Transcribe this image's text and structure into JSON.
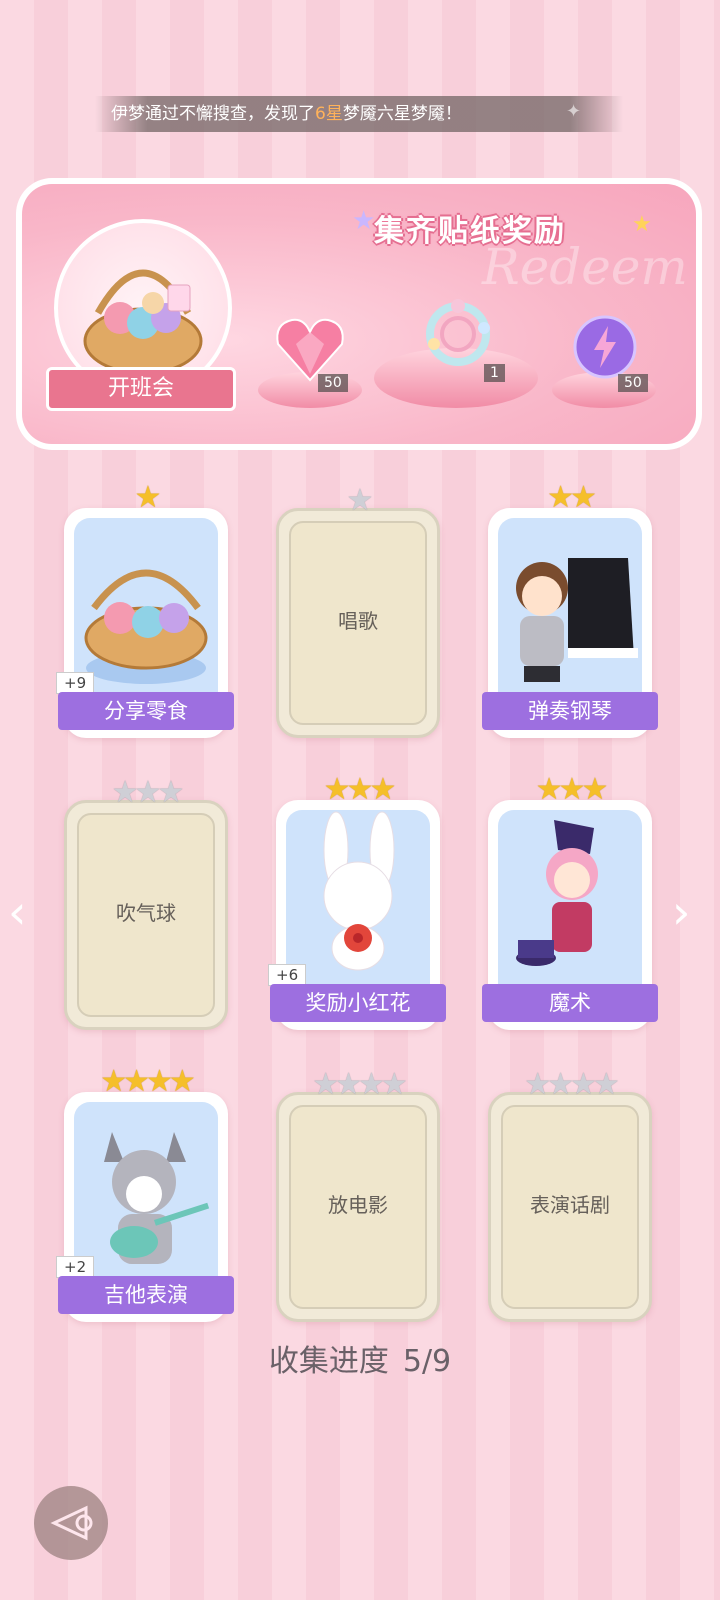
{
  "notice": {
    "text_before": "伊梦通过不懈搜查，发现了",
    "highlight": "6星",
    "text_after": "梦魇六星梦魇！"
  },
  "banner": {
    "title": "集齐贴纸奖励",
    "watermark": "Redeem",
    "main_reward_label": "开班会",
    "rewards": [
      {
        "icon": "pink-heart-gem-icon",
        "count": "50"
      },
      {
        "icon": "flower-ring-icon",
        "count": "1"
      },
      {
        "icon": "purple-lightning-orb-icon",
        "count": "50"
      }
    ]
  },
  "cards": [
    {
      "name": "分享零食",
      "stars_total": 1,
      "stars_earned": 1,
      "collected": true,
      "plus": "+9"
    },
    {
      "name": "唱歌",
      "stars_total": 1,
      "stars_earned": 0,
      "collected": false,
      "plus": ""
    },
    {
      "name": "弹奏钢琴",
      "stars_total": 2,
      "stars_earned": 2,
      "collected": true,
      "plus": ""
    },
    {
      "name": "吹气球",
      "stars_total": 3,
      "stars_earned": 0,
      "collected": false,
      "plus": ""
    },
    {
      "name": "奖励小红花",
      "stars_total": 3,
      "stars_earned": 3,
      "collected": true,
      "plus": "+6"
    },
    {
      "name": "魔术",
      "stars_total": 3,
      "stars_earned": 3,
      "collected": true,
      "plus": ""
    },
    {
      "name": "吉他表演",
      "stars_total": 4,
      "stars_earned": 4,
      "collected": true,
      "plus": "+2"
    },
    {
      "name": "放电影",
      "stars_total": 4,
      "stars_earned": 0,
      "collected": false,
      "plus": ""
    },
    {
      "name": "表演话剧",
      "stars_total": 4,
      "stars_earned": 0,
      "collected": false,
      "plus": ""
    }
  ],
  "progress": {
    "label": "收集进度",
    "value": "5/9"
  },
  "icons": {
    "prev": "chevron-left-icon",
    "next": "chevron-right-icon",
    "back": "back-icon"
  },
  "colors": {
    "name_band": "#9d6fe0",
    "gold_star": "#f5bf2a",
    "highlight": "#ffb25a"
  }
}
